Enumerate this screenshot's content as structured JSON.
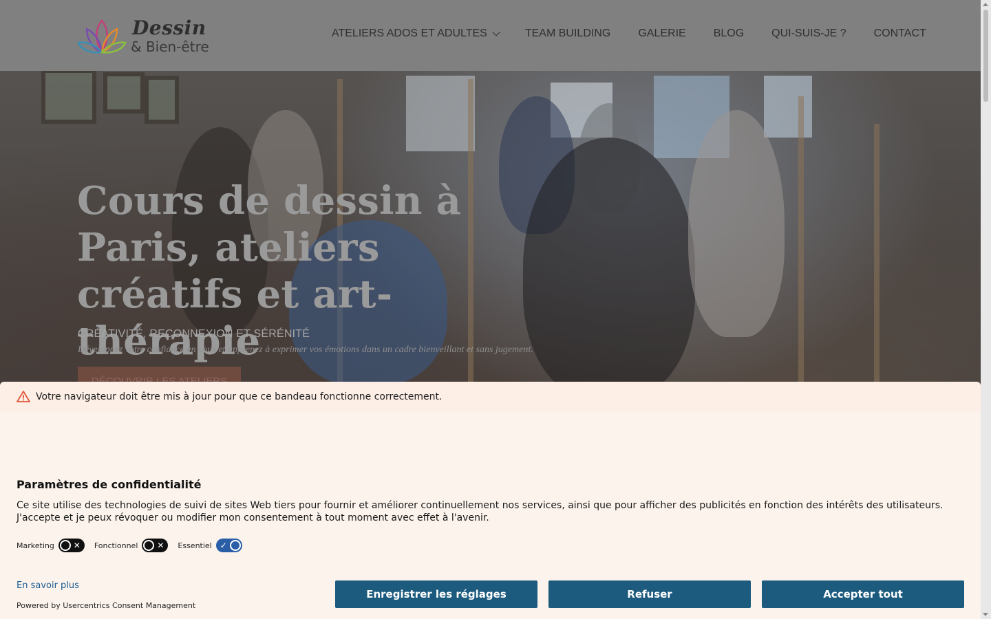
{
  "header": {
    "logo": {
      "word1": "Dessin",
      "word2": "& Bien-être"
    },
    "nav": [
      {
        "label": "ATELIERS ADOS ET ADULTES",
        "has_dropdown": true
      },
      {
        "label": "TEAM BUILDING"
      },
      {
        "label": "GALERIE"
      },
      {
        "label": "BLOG"
      },
      {
        "label": "QUI-SUIS-JE ?"
      },
      {
        "label": "CONTACT"
      }
    ]
  },
  "hero": {
    "title": "Cours de dessin à Paris, ateliers créatifs et art-thérapie",
    "subtitle": "CRÉATIVITÉ, RECONNEXION ET SÉRÉNITÉ",
    "description": "Développez votre confiance en vous et apprenez à exprimer vos émotions dans un cadre bienveillant et sans jugement.",
    "cta": "DÉCOUVRIR LES ATELIERS"
  },
  "consent": {
    "warning": "Votre navigateur doit être mis à jour pour que ce bandeau fonctionne correctement.",
    "title": "Paramètres de confidentialité",
    "body": "Ce site utilise des technologies de suivi de sites Web tiers pour fournir et améliorer continuellement nos services, ainsi que pour afficher des publicités en fonction des intérêts des utilisateurs. J'accepte et je peux révoquer ou modifier mon consentement à tout moment avec effet à l'avenir.",
    "toggles": [
      {
        "label": "Marketing",
        "on": false
      },
      {
        "label": "Fonctionnel",
        "on": false
      },
      {
        "label": "Essentiel",
        "on": true
      }
    ],
    "more_link": "En savoir plus",
    "powered": "Powered by Usercentrics Consent Management",
    "buttons": {
      "save": "Enregistrer les réglages",
      "refuse": "Refuser",
      "accept": "Accepter tout"
    }
  },
  "colors": {
    "header_bg": "#808080",
    "consent_bg": "#fbf3ec",
    "button_bg": "#1c5b7e",
    "link": "#1b5b92",
    "toggle_on": "#2a5fa8"
  },
  "icons": [
    "lotus-logo-icon",
    "chevron-down-icon",
    "warning-icon",
    "x-icon",
    "check-icon"
  ]
}
